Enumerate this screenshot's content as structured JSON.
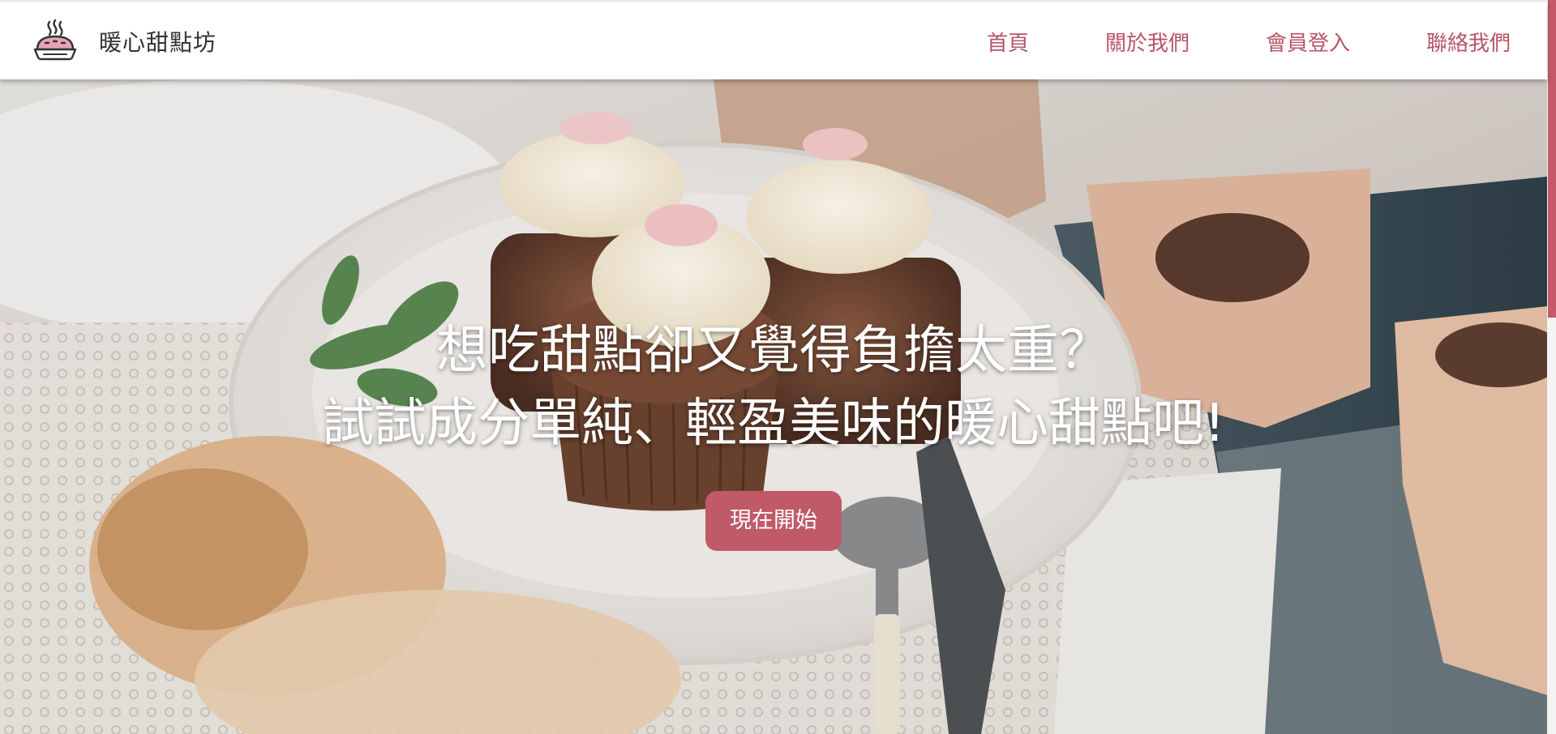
{
  "brand": {
    "name": "暖心甜點坊",
    "logo_icon": "steaming-pie-icon"
  },
  "nav": {
    "items": [
      {
        "label": "首頁"
      },
      {
        "label": "關於我們"
      },
      {
        "label": "會員登入"
      },
      {
        "label": "聯絡我們"
      }
    ]
  },
  "hero": {
    "title_line1": "想吃甜點卻又覺得負擔太重？",
    "title_line2": "試試成分單純、輕盈美味的暖心甜點吧!",
    "cta_label": "現在開始",
    "background": "cupcakes-on-plate-photo"
  },
  "colors": {
    "accent": "#c05a68",
    "nav_text": "#b85565",
    "brand_text": "#333333"
  }
}
